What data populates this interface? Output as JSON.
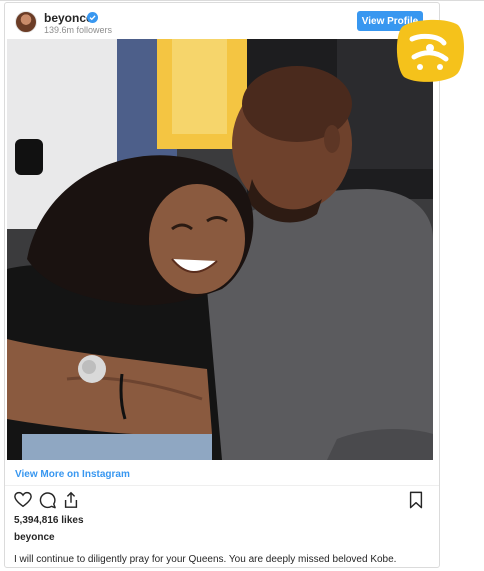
{
  "header": {
    "username": "beyonce",
    "followers": "139.6m followers",
    "view_profile_label": "View Profile"
  },
  "post": {
    "view_more_label": "View More on Instagram",
    "likes": "5,394,816 likes",
    "owner": "beyonce",
    "caption": "I will continue to diligently pray for your Queens. You are deeply missed beloved Kobe."
  },
  "icons": {
    "verified": "verified-badge-icon",
    "like": "heart-icon",
    "comment": "comment-icon",
    "share": "share-icon",
    "save": "bookmark-icon"
  },
  "colors": {
    "accent": "#3897f0",
    "watermark": "#f5c21b"
  }
}
